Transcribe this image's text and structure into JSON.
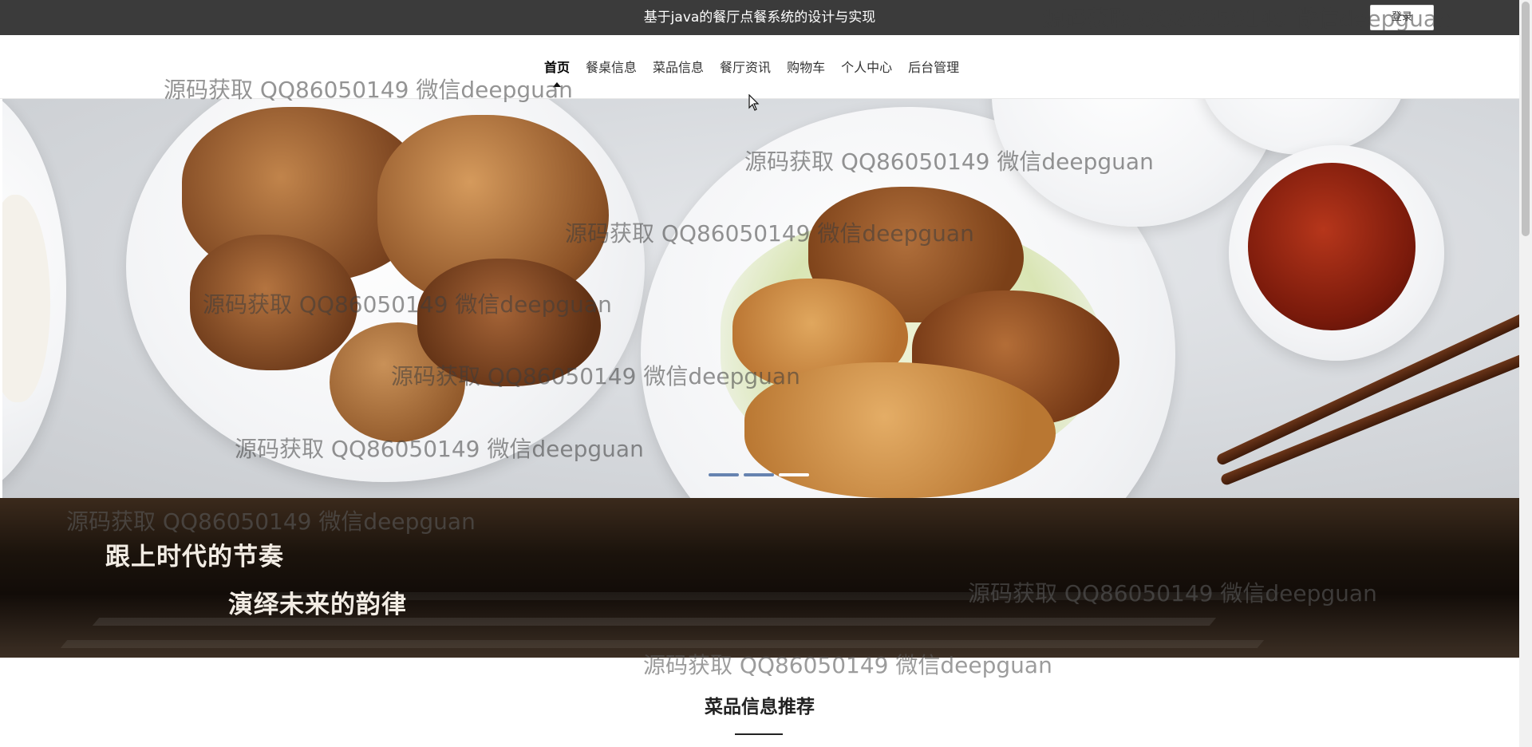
{
  "header": {
    "site_title": "基于java的餐厅点餐系统的设计与实现",
    "login_button": "登录"
  },
  "nav": {
    "items": [
      {
        "label": "首页",
        "active": true
      },
      {
        "label": "餐桌信息",
        "active": false
      },
      {
        "label": "菜品信息",
        "active": false
      },
      {
        "label": "餐厅资讯",
        "active": false
      },
      {
        "label": "购物车",
        "active": false
      },
      {
        "label": "个人中心",
        "active": false
      },
      {
        "label": "后台管理",
        "active": false
      }
    ]
  },
  "banner": {
    "slides_count": 3,
    "current_slide": 3
  },
  "slogan": {
    "line1": "跟上时代的节奏",
    "line2": "演绎未来的韵律"
  },
  "section": {
    "title": "菜品信息推荐"
  },
  "watermark": {
    "text": "源码获取 QQ86050149 微信deepguan"
  },
  "colors": {
    "topbar": "#3b3b3b",
    "accent_dot": "#4c6ea3"
  }
}
